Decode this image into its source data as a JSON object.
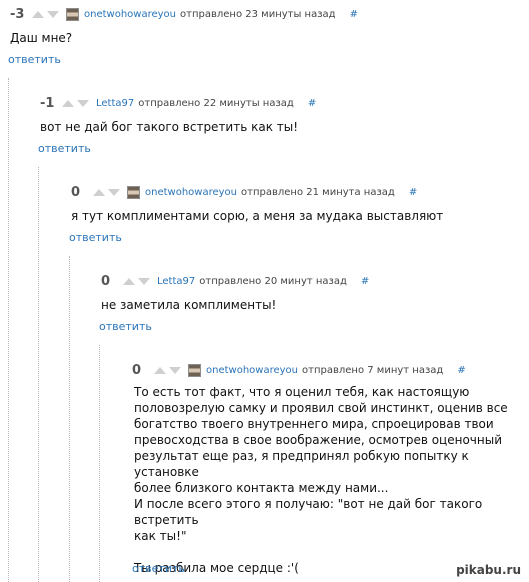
{
  "comments": [
    {
      "score": "-3",
      "user": "onetwohowareyou",
      "meta": "отправлено 23 минуты назад",
      "hash": "#",
      "text": "Даш мне?",
      "reply": "ответить"
    },
    {
      "score": "-1",
      "user": "Letta97",
      "meta": "отправлено 22 минуты назад",
      "hash": "#",
      "text": "вот не дай бог такого встретить как ты!",
      "reply": "ответить"
    },
    {
      "score": "0",
      "user": "onetwohowareyou",
      "meta": "отправлено 21 минута назад",
      "hash": "#",
      "text": "я тут комплиментами сорю, а меня за мудака выставляют",
      "reply": "ответить"
    },
    {
      "score": "0",
      "user": "Letta97",
      "meta": "отправлено 20 минут назад",
      "hash": "#",
      "text": "не заметила комплименты!",
      "reply": "ответить"
    },
    {
      "score": "0",
      "user": "onetwohowareyou",
      "meta": "отправлено 7 минут назад",
      "hash": "#",
      "lines": [
        "То есть тот факт, что я оценил тебя, как настоящую",
        "половозрелую самку и проявил свой инстинкт, оценив все",
        "богатство твоего внутреннего мира, спроецировав твои",
        "превосходства в свое воображение, осмотрев оценочный",
        "результат еще раз, я предпринял робкую попытку к установке",
        "более близкого контакта между нами...",
        "И после всего этого я получаю: \"вот не дай бог такого встретить",
        "как ты!\"",
        "",
        "Ты разбила мое сердце :'("
      ],
      "reply": "ответить"
    }
  ],
  "watermark": "pikabu.ru"
}
